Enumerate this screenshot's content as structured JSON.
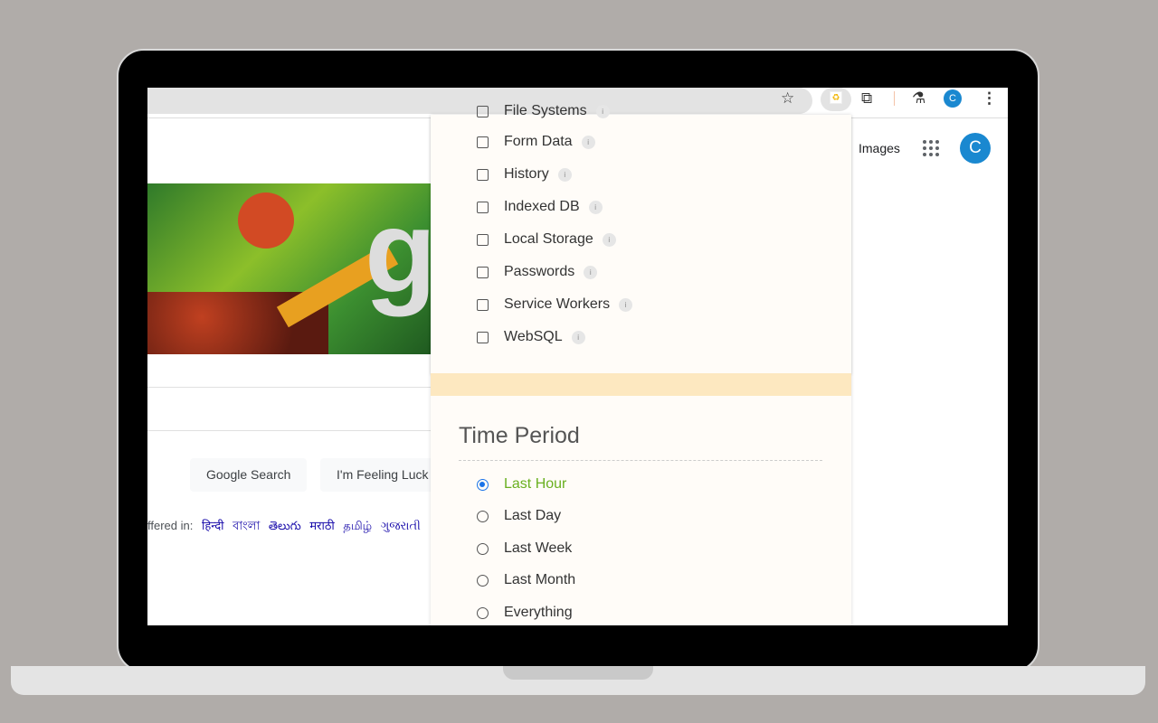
{
  "google": {
    "images_link": "Images",
    "avatar_letter": "C",
    "search_button": "Google Search",
    "lucky_button": "I'm Feeling Luck",
    "offered_in": "ffered in:",
    "languages": [
      "हिन्दी",
      "বাংলা",
      "తెలుగు",
      "मराठी",
      "தமிழ்",
      "ગુજરાતી"
    ]
  },
  "browser": {
    "profile_letter": "C"
  },
  "popup": {
    "data_types": [
      {
        "label": "File Systems",
        "checked": false
      },
      {
        "label": "Form Data",
        "checked": false
      },
      {
        "label": "History",
        "checked": false
      },
      {
        "label": "Indexed DB",
        "checked": false
      },
      {
        "label": "Local Storage",
        "checked": false
      },
      {
        "label": "Passwords",
        "checked": false
      },
      {
        "label": "Service Workers",
        "checked": false
      },
      {
        "label": "WebSQL",
        "checked": false
      }
    ],
    "info_glyph": "i",
    "time_period": {
      "title": "Time Period",
      "options": [
        {
          "label": "Last Hour",
          "selected": true
        },
        {
          "label": "Last Day",
          "selected": false
        },
        {
          "label": "Last Week",
          "selected": false
        },
        {
          "label": "Last Month",
          "selected": false
        },
        {
          "label": "Everything",
          "selected": false
        }
      ]
    },
    "accent_color": "#6ab020"
  }
}
